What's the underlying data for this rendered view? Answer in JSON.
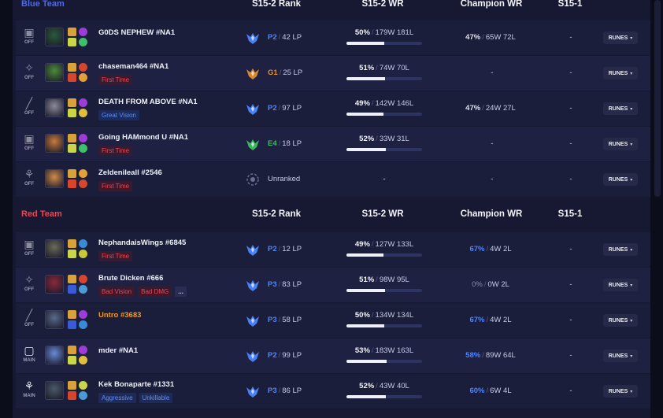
{
  "columns": {
    "rank": "S15-2 Rank",
    "wr": "S15-2 WR",
    "champ_wr": "Champion WR",
    "prev": "S15-1"
  },
  "blue_team": {
    "name": "Blue Team",
    "players": [
      {
        "role_icon": "middle-lane-icon",
        "role": "OFF",
        "summoner": "G0DS NEPHEW #NA1",
        "tags": [],
        "tier": "P2",
        "tier_color": "#4d86ff",
        "lp": "42 LP",
        "wr_pct": "50%",
        "wl": "179W 181L",
        "wr_fraction": 0.5,
        "champ_wr": "47%",
        "champ_wl": "65W 72L",
        "champ_wr_style": "normal",
        "prev": "-",
        "runes_label": "RUNES",
        "champ_color": "#2b5a3c",
        "spells": [
          "#d7a23a",
          "#c8d648"
        ],
        "runes": [
          "#9b3dd6",
          "#3fbf6b"
        ]
      },
      {
        "role_icon": "jungle-icon",
        "role": "OFF",
        "summoner": "chaseman464 #NA1",
        "tags": [
          {
            "text": "First Time",
            "style": "red"
          }
        ],
        "tier": "G1",
        "tier_color": "#e08f2c",
        "lp": "25 LP",
        "wr_pct": "51%",
        "wl": "74W 70L",
        "wr_fraction": 0.51,
        "champ_wr": "-",
        "champ_wl": "",
        "champ_wr_style": "none",
        "prev": "-",
        "runes_label": "RUNES",
        "champ_color": "#4e8a3a",
        "spells": [
          "#d7a23a",
          "#d6462f"
        ],
        "runes": [
          "#d6462f",
          "#e0a03a"
        ]
      },
      {
        "role_icon": "top-lane-icon",
        "role": "OFF",
        "summoner": "DEATH FROM ABOVE #NA1",
        "tags": [
          {
            "text": "Great Vision",
            "style": "blue"
          }
        ],
        "tier": "P2",
        "tier_color": "#4d86ff",
        "lp": "97 LP",
        "wr_pct": "49%",
        "wl": "142W 146L",
        "wr_fraction": 0.49,
        "champ_wr": "47%",
        "champ_wl": "24W 27L",
        "champ_wr_style": "normal",
        "prev": "-",
        "runes_label": "RUNES",
        "champ_color": "#8a8a9a",
        "spells": [
          "#d7a23a",
          "#c8d648"
        ],
        "runes": [
          "#9b3dd6",
          "#e0c03a"
        ]
      },
      {
        "role_icon": "middle-lane-icon",
        "role": "OFF",
        "summoner": "Going HAMmond U #NA1",
        "tags": [
          {
            "text": "First Time",
            "style": "red"
          }
        ],
        "tier": "E4",
        "tier_color": "#3bbf5a",
        "lp": "18 LP",
        "wr_pct": "52%",
        "wl": "33W 31L",
        "wr_fraction": 0.52,
        "champ_wr": "-",
        "champ_wl": "",
        "champ_wr_style": "none",
        "prev": "-",
        "runes_label": "RUNES",
        "champ_color": "#c87a3a",
        "spells": [
          "#d7a23a",
          "#c8d648"
        ],
        "runes": [
          "#9b3dd6",
          "#3fbf6b"
        ]
      },
      {
        "role_icon": "support-icon",
        "role": "OFF",
        "summoner": "Zeldenileall #2546",
        "tags": [
          {
            "text": "First Time",
            "style": "red"
          }
        ],
        "tier": "",
        "tier_color": "#c8cae6",
        "lp": "Unranked",
        "wr_pct": "",
        "wl": "-",
        "wr_fraction": 0,
        "champ_wr": "-",
        "champ_wl": "",
        "champ_wr_style": "none",
        "prev": "-",
        "runes_label": "RUNES",
        "champ_color": "#d08a4a",
        "spells": [
          "#d7a23a",
          "#d6462f"
        ],
        "runes": [
          "#e0a03a",
          "#d6462f"
        ]
      }
    ]
  },
  "red_team": {
    "name": "Red Team",
    "players": [
      {
        "role_icon": "middle-lane-icon",
        "role": "OFF",
        "summoner": "NephandaisWings #6845",
        "tags": [
          {
            "text": "First Time",
            "style": "red"
          }
        ],
        "tier": "P2",
        "tier_color": "#4d86ff",
        "lp": "12 LP",
        "wr_pct": "49%",
        "wl": "127W 133L",
        "wr_fraction": 0.49,
        "champ_wr": "67%",
        "champ_wl": "4W 2L",
        "champ_wr_style": "good",
        "prev": "-",
        "runes_label": "RUNES",
        "champ_color": "#6a6a5a",
        "spells": [
          "#d7a23a",
          "#c8d648"
        ],
        "runes": [
          "#3a8ad6",
          "#c8c83a"
        ]
      },
      {
        "role_icon": "jungle-icon",
        "role": "OFF",
        "summoner": "Brute Dicken #666",
        "tags": [
          {
            "text": "Bad Vision",
            "style": "red"
          },
          {
            "text": "Bad DMG",
            "style": "red"
          },
          {
            "text": "...",
            "style": "more"
          }
        ],
        "tier": "P3",
        "tier_color": "#4d86ff",
        "lp": "83 LP",
        "wr_pct": "51%",
        "wl": "98W 95L",
        "wr_fraction": 0.51,
        "champ_wr": "0%",
        "champ_wl": "0W 2L",
        "champ_wr_style": "zero",
        "prev": "-",
        "runes_label": "RUNES",
        "champ_color": "#8a2a3a",
        "spells": [
          "#d7a23a",
          "#3a5ad6"
        ],
        "runes": [
          "#d6462f",
          "#4a9ad6"
        ]
      },
      {
        "role_icon": "top-lane-icon",
        "role": "OFF",
        "summoner": "Untro #3683",
        "tags": [],
        "highlight": true,
        "tier": "P3",
        "tier_color": "#4d86ff",
        "lp": "58 LP",
        "wr_pct": "50%",
        "wl": "134W 134L",
        "wr_fraction": 0.5,
        "champ_wr": "67%",
        "champ_wl": "4W 2L",
        "champ_wr_style": "good",
        "prev": "-",
        "runes_label": "RUNES",
        "champ_color": "#5a6a8a",
        "spells": [
          "#d7a23a",
          "#3a5ad6"
        ],
        "runes": [
          "#9b3dd6",
          "#3a8ad6"
        ]
      },
      {
        "role_icon": "bottom-lane-icon",
        "role": "MAIN",
        "summoner": "mder #NA1",
        "tags": [],
        "tier": "P2",
        "tier_color": "#4d86ff",
        "lp": "99 LP",
        "wr_pct": "53%",
        "wl": "183W 163L",
        "wr_fraction": 0.53,
        "champ_wr": "58%",
        "champ_wl": "89W 64L",
        "champ_wr_style": "good",
        "prev": "-",
        "runes_label": "RUNES",
        "champ_color": "#6a8ad6",
        "spells": [
          "#d7a23a",
          "#c8d648"
        ],
        "runes": [
          "#9b3dd6",
          "#e0c03a"
        ]
      },
      {
        "role_icon": "support-icon",
        "role": "MAIN",
        "summoner": "Kek Bonaparte #1331",
        "tags": [
          {
            "text": "Aggressive",
            "style": "blue"
          },
          {
            "text": "Unkillable",
            "style": "blue"
          }
        ],
        "tier": "P3",
        "tier_color": "#4d86ff",
        "lp": "86 LP",
        "wr_pct": "52%",
        "wl": "43W 40L",
        "wr_fraction": 0.52,
        "champ_wr": "60%",
        "champ_wl": "6W 4L",
        "champ_wr_style": "good",
        "prev": "-",
        "runes_label": "RUNES",
        "champ_color": "#4a5a6a",
        "spells": [
          "#d7a23a",
          "#d6462f"
        ],
        "runes": [
          "#c8d648",
          "#4a9ad6"
        ]
      }
    ]
  }
}
